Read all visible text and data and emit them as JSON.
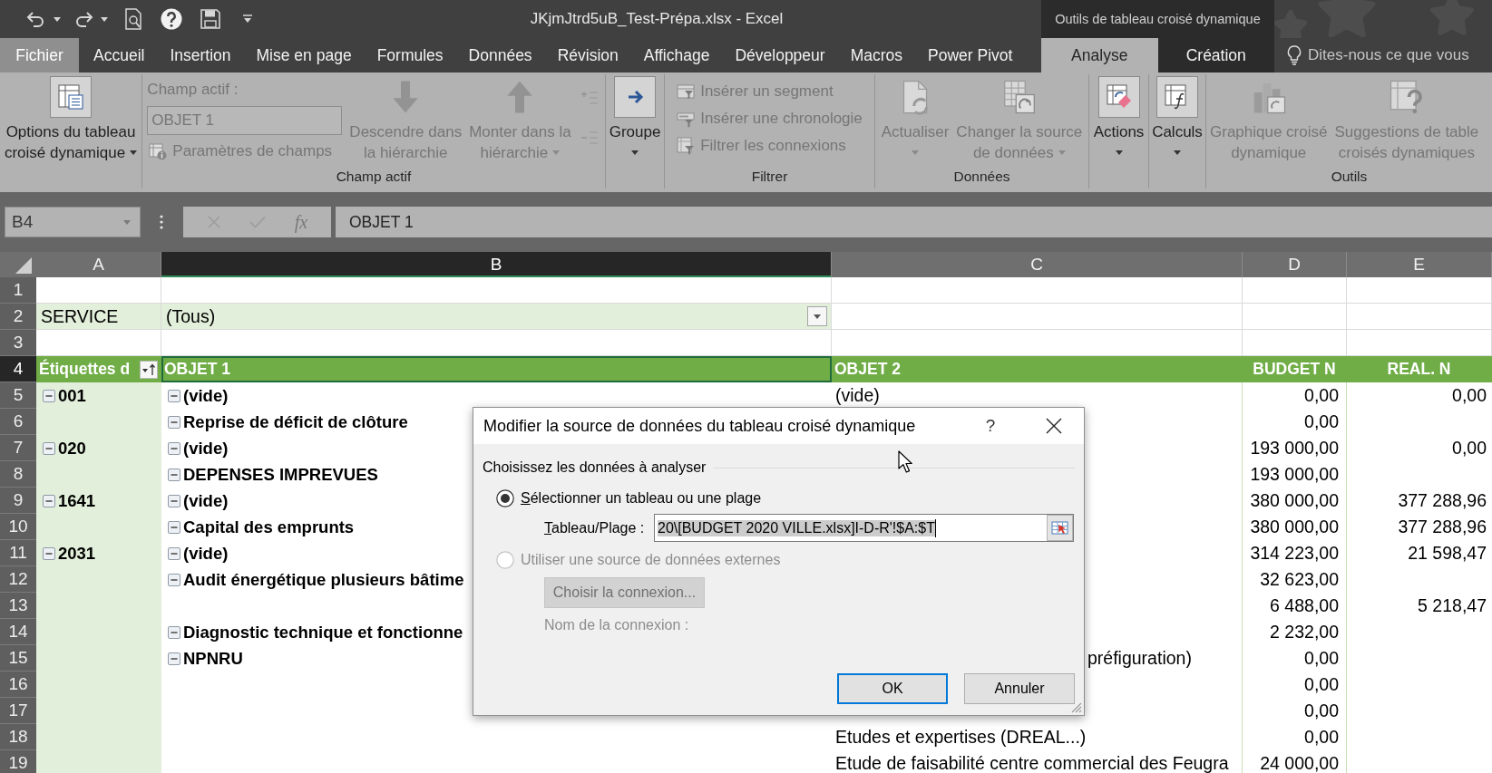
{
  "window": {
    "title": "JKjmJtrd5uB_Test-Prépa.xlsx - Excel",
    "contextual_header": "Outils de tableau croisé dynamique"
  },
  "tabs": [
    {
      "label": "Fichier",
      "kind": "file",
      "selected": false
    },
    {
      "label": "Accueil",
      "kind": "standard",
      "selected": false
    },
    {
      "label": "Insertion",
      "kind": "standard",
      "selected": false
    },
    {
      "label": "Mise en page",
      "kind": "standard",
      "selected": false
    },
    {
      "label": "Formules",
      "kind": "standard",
      "selected": false
    },
    {
      "label": "Données",
      "kind": "standard",
      "selected": false
    },
    {
      "label": "Révision",
      "kind": "standard",
      "selected": false
    },
    {
      "label": "Affichage",
      "kind": "standard",
      "selected": false
    },
    {
      "label": "Développeur",
      "kind": "standard",
      "selected": false
    },
    {
      "label": "Macros",
      "kind": "standard",
      "selected": false
    },
    {
      "label": "Power Pivot",
      "kind": "standard",
      "selected": false
    },
    {
      "label": "Analyse",
      "kind": "contextual",
      "selected": true
    },
    {
      "label": "Création",
      "kind": "contextual",
      "selected": false
    }
  ],
  "tell_me": {
    "placeholder": "Dites-nous ce que vous"
  },
  "ribbon": {
    "groups": [
      {
        "items": [
          {
            "kind": "large",
            "lines": [
              "Options du tableau",
              "croisé dynamique"
            ],
            "dropdown": true,
            "disabled": false
          }
        ]
      },
      {
        "label": "Champ actif",
        "items": [
          {
            "kind": "caption",
            "label": "Champ actif :",
            "disabled": true
          },
          {
            "kind": "field",
            "value": "OBJET 1",
            "disabled": true
          },
          {
            "kind": "small",
            "label": "Paramètres de champs",
            "disabled": true
          },
          {
            "kind": "large",
            "lines": [
              "Descendre dans",
              "la hiérarchie"
            ],
            "dropdown": false,
            "disabled": true
          },
          {
            "kind": "large",
            "lines": [
              "Monter dans la",
              "hiérarchie"
            ],
            "dropdown": true,
            "disabled": true
          },
          {
            "kind": "icon",
            "disabled": true
          },
          {
            "kind": "icon",
            "disabled": true
          }
        ]
      },
      {
        "items": [
          {
            "kind": "large",
            "lines": [
              "Groupe"
            ],
            "dropdown": true,
            "disabled": false
          }
        ]
      },
      {
        "label": "Filtrer",
        "items": [
          {
            "kind": "small",
            "label": "Insérer un segment",
            "disabled": true
          },
          {
            "kind": "small",
            "label": "Insérer une chronologie",
            "disabled": true
          },
          {
            "kind": "small",
            "label": "Filtrer les connexions",
            "disabled": true
          }
        ]
      },
      {
        "label": "Données",
        "items": [
          {
            "kind": "large",
            "lines": [
              "Actualiser"
            ],
            "dropdown": true,
            "disabled": true
          },
          {
            "kind": "large",
            "lines": [
              "Changer la source",
              "de données"
            ],
            "dropdown": true,
            "disabled": true
          }
        ]
      },
      {
        "items": [
          {
            "kind": "large",
            "lines": [
              "Actions"
            ],
            "dropdown": true,
            "disabled": false
          }
        ]
      },
      {
        "items": [
          {
            "kind": "large",
            "lines": [
              "Calculs"
            ],
            "dropdown": true,
            "disabled": false
          }
        ]
      },
      {
        "label": "Outils",
        "items": [
          {
            "kind": "large",
            "lines": [
              "Graphique croisé",
              "dynamique"
            ],
            "dropdown": false,
            "disabled": true
          },
          {
            "kind": "large",
            "lines": [
              "Suggestions de table",
              "croisés dynamiques"
            ],
            "dropdown": false,
            "disabled": true
          }
        ]
      }
    ]
  },
  "formula_bar": {
    "name_box": {
      "value": "B4"
    },
    "function_label": "fx",
    "formula": {
      "value": "OBJET 1"
    }
  },
  "sheet": {
    "columns": [
      {
        "label": "A",
        "selected": false
      },
      {
        "label": "B",
        "selected": true
      },
      {
        "label": "C",
        "selected": false
      },
      {
        "label": "D",
        "selected": false
      },
      {
        "label": "E",
        "selected": false
      }
    ],
    "rows": [
      {
        "number": "1",
        "kind": "blank",
        "selected": false
      },
      {
        "number": "2",
        "kind": "page_filter",
        "selected": false,
        "cells": {
          "a": {
            "text": "SERVICE"
          },
          "b": {
            "text": "(Tous)",
            "dropdown": true
          }
        }
      },
      {
        "number": "3",
        "kind": "blank",
        "selected": false
      },
      {
        "number": "4",
        "kind": "header",
        "selected": true,
        "cells": {
          "a": {
            "text": "Étiquettes d",
            "filter_button": true
          },
          "b": {
            "text": "OBJET 1"
          },
          "c": {
            "text": "OBJET 2"
          },
          "d": {
            "text": "BUDGET N"
          },
          "e": {
            "text": "REAL. N"
          }
        }
      },
      {
        "number": "5",
        "kind": "item",
        "selected": false,
        "cells": {
          "a": {
            "text": "001",
            "expanded": true
          },
          "b": {
            "text": "(vide)",
            "expanded": true
          },
          "c": {
            "text": "(vide)"
          },
          "d": {
            "text": "0,00"
          },
          "e": {
            "text": "0,00"
          }
        }
      },
      {
        "number": "6",
        "kind": "item",
        "selected": false,
        "cells": {
          "b": {
            "text": "Reprise de déficit de clôture",
            "expanded": true
          },
          "d": {
            "text": "0,00"
          }
        }
      },
      {
        "number": "7",
        "kind": "item",
        "selected": false,
        "cells": {
          "a": {
            "text": "020",
            "expanded": true
          },
          "b": {
            "text": "(vide)",
            "expanded": true
          },
          "d": {
            "text": "193 000,00"
          },
          "e": {
            "text": "0,00"
          }
        }
      },
      {
        "number": "8",
        "kind": "item",
        "selected": false,
        "cells": {
          "b": {
            "text": "DEPENSES IMPREVUES",
            "expanded": true
          },
          "d": {
            "text": "193 000,00"
          }
        }
      },
      {
        "number": "9",
        "kind": "item",
        "selected": false,
        "cells": {
          "a": {
            "text": "1641",
            "expanded": true
          },
          "b": {
            "text": "(vide)",
            "expanded": true
          },
          "d": {
            "text": "380 000,00"
          },
          "e": {
            "text": "377 288,96"
          }
        }
      },
      {
        "number": "10",
        "kind": "item",
        "selected": false,
        "cells": {
          "b": {
            "text": "Capital des emprunts",
            "expanded": true
          },
          "d": {
            "text": "380 000,00"
          },
          "e": {
            "text": "377 288,96"
          }
        }
      },
      {
        "number": "11",
        "kind": "item",
        "selected": false,
        "cells": {
          "a": {
            "text": "2031",
            "expanded": true
          },
          "b": {
            "text": "(vide)",
            "expanded": true
          },
          "d": {
            "text": "314 223,00"
          },
          "e": {
            "text": "21 598,47"
          }
        }
      },
      {
        "number": "12",
        "kind": "item",
        "selected": false,
        "cells": {
          "b": {
            "text": "Audit énergétique plusieurs bâtime",
            "expanded": true
          },
          "d": {
            "text": "32 623,00"
          }
        }
      },
      {
        "number": "13",
        "kind": "item",
        "selected": false,
        "cells": {
          "d": {
            "text": "6 488,00"
          },
          "e": {
            "text": "5 218,47"
          }
        }
      },
      {
        "number": "14",
        "kind": "item",
        "selected": false,
        "cells": {
          "b": {
            "text": "Diagnostic technique et fonctionne",
            "expanded": true
          },
          "d": {
            "text": "2 232,00"
          }
        }
      },
      {
        "number": "15",
        "kind": "item",
        "selected": false,
        "cells": {
          "b": {
            "text": "NPNRU",
            "expanded": true
          },
          "c": {
            "text": "préfiguration)"
          },
          "d": {
            "text": "0,00"
          }
        }
      },
      {
        "number": "16",
        "kind": "item",
        "selected": false,
        "cells": {
          "d": {
            "text": "0,00"
          }
        }
      },
      {
        "number": "17",
        "kind": "item",
        "selected": false,
        "cells": {
          "d": {
            "text": "0,00"
          }
        }
      },
      {
        "number": "18",
        "kind": "item",
        "selected": false,
        "cells": {
          "c": {
            "text": "Etudes et expertises (DREAL...)"
          },
          "d": {
            "text": "0,00"
          }
        }
      },
      {
        "number": "19",
        "kind": "item",
        "selected": false,
        "cells": {
          "c": {
            "text": "Etude de faisabilité centre commercial des Feugra"
          },
          "d": {
            "text": "24 000,00"
          }
        }
      }
    ]
  },
  "dialog": {
    "title": "Modifier la source de données du tableau croisé dynamique",
    "help_label": "?",
    "section_label": "Choisissez les données à analyser",
    "options": [
      {
        "label": "Sélectionner un tableau ou une plage",
        "selected": true,
        "disabled": false,
        "mnemonic": true,
        "range_field": {
          "label": "Tableau/Plage :",
          "mnemonic": true,
          "value": "20\\[BUDGET 2020 VILLE.xlsx]I-D-R'!$A:$T",
          "text_selected": true
        }
      },
      {
        "label": "Utiliser une source de données externes",
        "selected": false,
        "disabled": true,
        "mnemonic": false,
        "connection_button": {
          "label": "Choisir la connexion...",
          "disabled": true
        },
        "connection_name": {
          "label": "Nom de la connexion :",
          "disabled": true
        }
      }
    ],
    "buttons": [
      {
        "label": "OK",
        "default": true
      },
      {
        "label": "Annuler",
        "default": false
      }
    ]
  }
}
